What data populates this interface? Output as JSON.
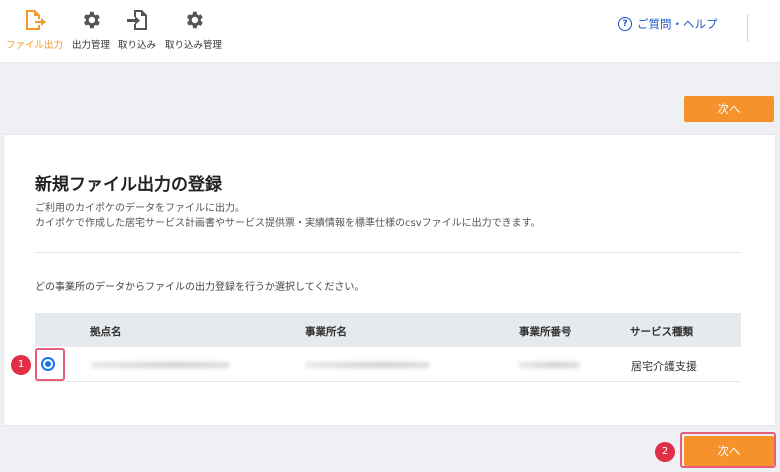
{
  "nav": {
    "items": [
      {
        "label": "ファイル出力",
        "icon": "file-export-icon",
        "active": true
      },
      {
        "label": "出力管理",
        "icon": "gear-icon",
        "active": false
      },
      {
        "label": "取り込み",
        "icon": "file-import-icon",
        "active": false
      },
      {
        "label": "取り込み管理",
        "icon": "gear-icon",
        "active": false
      }
    ],
    "help_label": "ご質問・ヘルプ",
    "help_icon_glyph": "?"
  },
  "buttons": {
    "next_top": "次へ",
    "next_bottom": "次へ"
  },
  "card": {
    "title": "新規ファイル出力の登録",
    "desc1": "ご利用のカイポケのデータをファイルに出力。",
    "desc2": "カイポケで作成した居宅サービス計画書やサービス提供票・実績情報を標準仕様のcsvファイルに出力できます。",
    "instruction": "どの事業所のデータからファイルの出力登録を行うか選択してください。"
  },
  "table": {
    "headers": [
      "拠点名",
      "事業所名",
      "事業所番号",
      "サービス種類"
    ],
    "rows": [
      {
        "selected": true,
        "base": "",
        "office": "",
        "office_no": "",
        "service": "居宅介護支援"
      }
    ]
  },
  "annotations": {
    "step1": "1",
    "step2": "2"
  },
  "colors": {
    "accent": "#f5922b",
    "highlight": "#e85d7a",
    "radio": "#1a73e8"
  }
}
